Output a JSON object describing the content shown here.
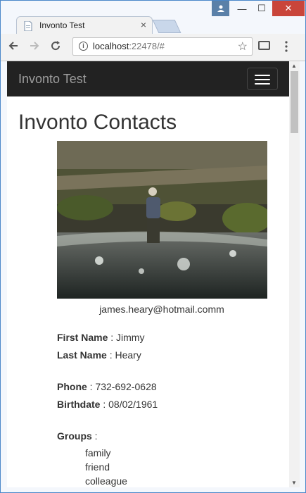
{
  "browser": {
    "tab_title": "Invonto Test",
    "tab_close": "×",
    "url_host": "localhost",
    "url_rest": ":22478/#",
    "window_controls": {
      "minimize": "—",
      "maximize": "☐",
      "close": "✕"
    }
  },
  "navbar": {
    "brand": "Invonto Test"
  },
  "page": {
    "title": "Invonto Contacts"
  },
  "contact": {
    "email": "james.heary@hotmail.comm",
    "first_name_label": "First Name",
    "first_name": "Jimmy",
    "last_name_label": "Last Name",
    "last_name": "Heary",
    "phone_label": "Phone",
    "phone": "732-692-0628",
    "birthdate_label": "Birthdate",
    "birthdate": "08/02/1961",
    "groups_label": "Groups",
    "groups": [
      "family",
      "friend",
      "colleague"
    ]
  },
  "colors": {
    "navbar_bg": "#222222",
    "brand_text": "#9d9d9d",
    "close_button": "#c9453a"
  },
  "icons": [
    "user-icon",
    "minimize-icon",
    "maximize-icon",
    "close-icon",
    "back-icon",
    "forward-icon",
    "reload-icon",
    "info-icon",
    "star-icon",
    "cast-icon",
    "menu-icon",
    "hamburger-icon"
  ]
}
